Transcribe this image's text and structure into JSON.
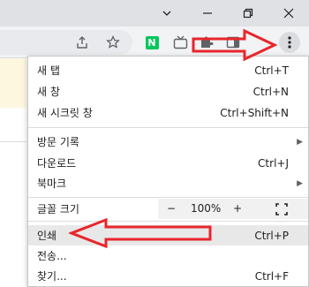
{
  "window": {
    "minimize_icon": "minimize-icon",
    "restore_icon": "restore-icon",
    "close_icon": "close-icon"
  },
  "toolbar": {
    "icons": [
      "share-icon",
      "bookmark-star-icon",
      "naver-extension-icon",
      "tv-extension-icon",
      "puzzle-extension-icon",
      "side-panel-icon",
      "kebab-menu-icon"
    ],
    "naver_letter": "N"
  },
  "menu": {
    "new_tab": {
      "label": "새 탭",
      "shortcut": "Ctrl+T"
    },
    "new_window": {
      "label": "새 창",
      "shortcut": "Ctrl+N"
    },
    "incognito": {
      "label": "새 시크릿 창",
      "shortcut": "Ctrl+Shift+N"
    },
    "history": {
      "label": "방문 기록"
    },
    "downloads": {
      "label": "다운로드",
      "shortcut": "Ctrl+J"
    },
    "bookmarks": {
      "label": "북마크"
    },
    "zoom": {
      "label": "글꼴 크기",
      "minus": "−",
      "value": "100%",
      "plus": "+"
    },
    "print": {
      "label": "인쇄",
      "shortcut": "Ctrl+P"
    },
    "cast": {
      "label": "전송..."
    },
    "find": {
      "label": "찾기...",
      "shortcut": "Ctrl+F"
    }
  },
  "colors": {
    "annotation_red": "#e8262b"
  }
}
